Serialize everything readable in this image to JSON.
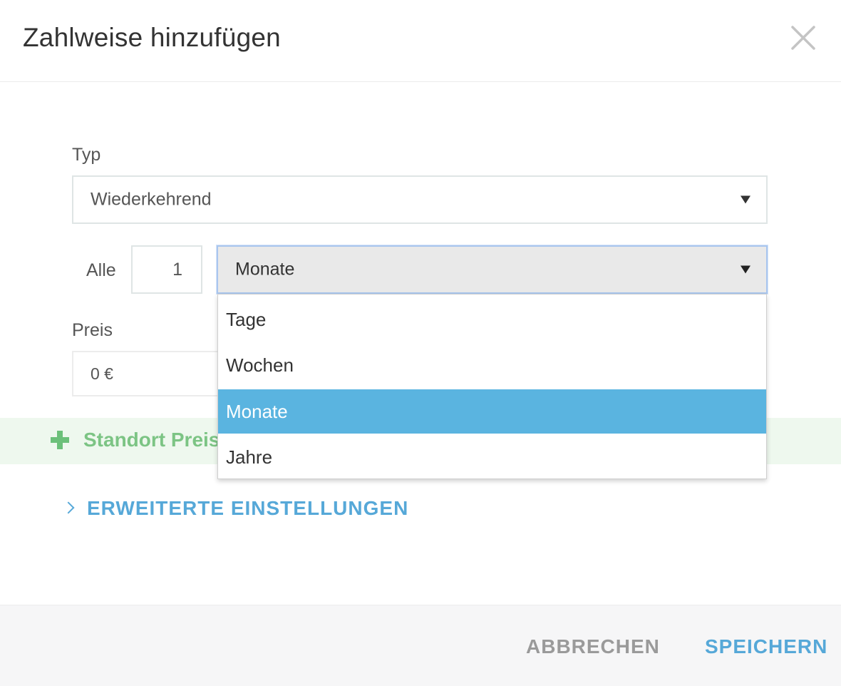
{
  "dialog": {
    "title": "Zahlweise hinzufügen",
    "close_icon": "close-icon"
  },
  "form": {
    "type_label": "Typ",
    "type_value": "Wiederkehrend",
    "interval_label": "Alle",
    "interval_value": "1",
    "unit_value": "Monate",
    "price_label": "Preis",
    "price_value": "0 €"
  },
  "unit_dropdown": {
    "options": [
      "Tage",
      "Wochen",
      "Monate",
      "Jahre"
    ],
    "selected": "Monate"
  },
  "location_price": {
    "label": "Standort Preis",
    "icon": "plus-icon"
  },
  "advanced": {
    "label": "ERWEITERTE EINSTELLUNGEN",
    "icon": "chevron-right-icon"
  },
  "footer": {
    "cancel_label": "ABBRECHEN",
    "save_label": "SPEICHERN"
  },
  "colors": {
    "accent": "#56a8d8",
    "selected_option": "#5ab4e0",
    "location_green": "#7cc484",
    "location_band": "#eef8ee"
  }
}
